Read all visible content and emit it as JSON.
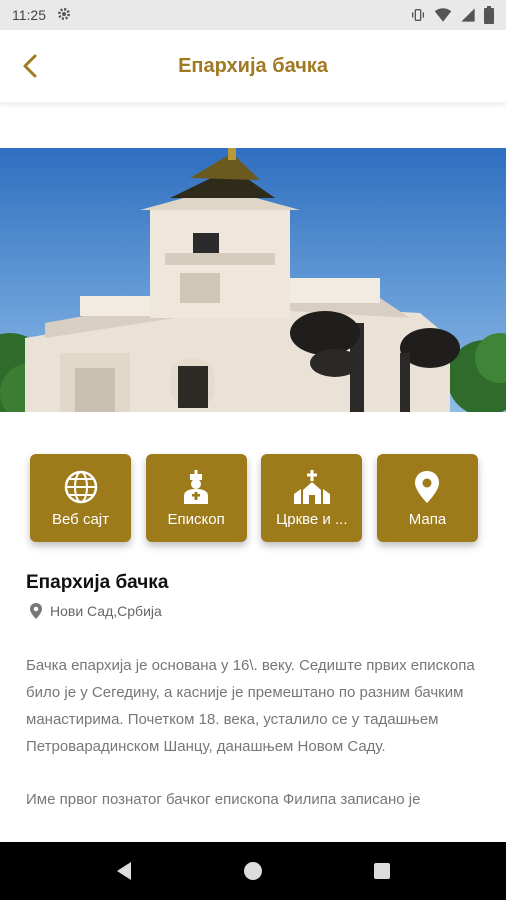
{
  "status_bar": {
    "time": "11:25"
  },
  "header": {
    "title": "Епархија бачка"
  },
  "actions": [
    {
      "label": "Веб сајт",
      "icon": "globe-icon"
    },
    {
      "label": "Епископ",
      "icon": "bishop-icon"
    },
    {
      "label": "Цркве и ...",
      "icon": "church-icon"
    },
    {
      "label": "Мапа",
      "icon": "map-pin-icon"
    }
  ],
  "content": {
    "title": "Епархија бачка",
    "location": "Нови Сад,Србија",
    "paragraphs": [
      "Бачка епархија је основана у 16\\. веку. Седиште првих епископа било је у Сегедину, а касније је премештано по разним бачким манастирима. Почетком 18. века, усталило се у тадашњем Петроварадинском Шанцу, данашњем Новом Саду.",
      "Име првог познатог бачког епископа Филипа записано је"
    ]
  },
  "colors": {
    "accent": "#9d7a1a",
    "title_accent": "#a07a22"
  }
}
